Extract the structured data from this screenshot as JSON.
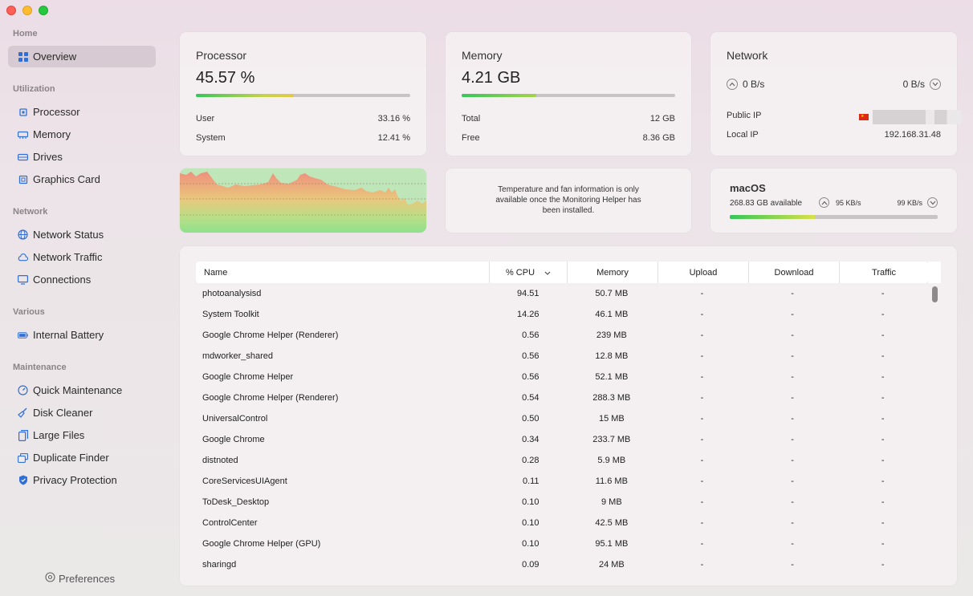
{
  "sidebar": {
    "sections": {
      "home": "Home",
      "utilization": "Utilization",
      "network": "Network",
      "various": "Various",
      "maintenance": "Maintenance"
    },
    "items": {
      "overview": "Overview",
      "processor": "Processor",
      "memory": "Memory",
      "drives": "Drives",
      "graphics": "Graphics Card",
      "network_status": "Network Status",
      "network_traffic": "Network Traffic",
      "connections": "Connections",
      "battery": "Internal Battery",
      "quick_maintenance": "Quick Maintenance",
      "disk_cleaner": "Disk Cleaner",
      "large_files": "Large Files",
      "duplicate_finder": "Duplicate Finder",
      "privacy": "Privacy Protection"
    },
    "preferences": "Preferences"
  },
  "processor": {
    "title": "Processor",
    "value": "45.57 %",
    "usage_fraction": 0.4557,
    "user_label": "User",
    "user_value": "33.16 %",
    "system_label": "System",
    "system_value": "12.41 %"
  },
  "memory": {
    "title": "Memory",
    "value": "4.21 GB",
    "usage_fraction": 0.35,
    "total_label": "Total",
    "total_value": "12 GB",
    "free_label": "Free",
    "free_value": "8.36 GB"
  },
  "network": {
    "title": "Network",
    "up_rate": "0 B/s",
    "down_rate": "0 B/s",
    "public_ip_label": "Public IP",
    "local_ip_label": "Local IP",
    "local_ip_value": "192.168.31.48"
  },
  "sensor_info": "Temperature and fan information is only available once the Monitoring Helper has been installed.",
  "disk": {
    "title": "macOS",
    "available": "268.83 GB available",
    "read_rate": "95 KB/s",
    "write_rate": "99 KB/s",
    "usage_fraction": 0.41
  },
  "table": {
    "headers": {
      "name": "Name",
      "cpu": "% CPU",
      "memory": "Memory",
      "upload": "Upload",
      "download": "Download",
      "traffic": "Traffic"
    },
    "rows": [
      {
        "name": "photoanalysisd",
        "cpu": "94.51",
        "memory": "50.7 MB",
        "upload": "-",
        "download": "-",
        "traffic": "-"
      },
      {
        "name": "System Toolkit",
        "cpu": "14.26",
        "memory": "46.1 MB",
        "upload": "-",
        "download": "-",
        "traffic": "-"
      },
      {
        "name": "Google Chrome Helper (Renderer)",
        "cpu": "0.56",
        "memory": "239 MB",
        "upload": "-",
        "download": "-",
        "traffic": "-"
      },
      {
        "name": "mdworker_shared",
        "cpu": "0.56",
        "memory": "12.8 MB",
        "upload": "-",
        "download": "-",
        "traffic": "-"
      },
      {
        "name": "Google Chrome Helper",
        "cpu": "0.56",
        "memory": "52.1 MB",
        "upload": "-",
        "download": "-",
        "traffic": "-"
      },
      {
        "name": "Google Chrome Helper (Renderer)",
        "cpu": "0.54",
        "memory": "288.3 MB",
        "upload": "-",
        "download": "-",
        "traffic": "-"
      },
      {
        "name": "UniversalControl",
        "cpu": "0.50",
        "memory": "15 MB",
        "upload": "-",
        "download": "-",
        "traffic": "-"
      },
      {
        "name": "Google Chrome",
        "cpu": "0.34",
        "memory": "233.7 MB",
        "upload": "-",
        "download": "-",
        "traffic": "-"
      },
      {
        "name": "distnoted",
        "cpu": "0.28",
        "memory": "5.9 MB",
        "upload": "-",
        "download": "-",
        "traffic": "-"
      },
      {
        "name": "CoreServicesUIAgent",
        "cpu": "0.11",
        "memory": "11.6 MB",
        "upload": "-",
        "download": "-",
        "traffic": "-"
      },
      {
        "name": "ToDesk_Desktop",
        "cpu": "0.10",
        "memory": "9 MB",
        "upload": "-",
        "download": "-",
        "traffic": "-"
      },
      {
        "name": "ControlCenter",
        "cpu": "0.10",
        "memory": "42.5 MB",
        "upload": "-",
        "download": "-",
        "traffic": "-"
      },
      {
        "name": "Google Chrome Helper (GPU)",
        "cpu": "0.10",
        "memory": "95.1 MB",
        "upload": "-",
        "download": "-",
        "traffic": "-"
      },
      {
        "name": "sharingd",
        "cpu": "0.09",
        "memory": "24 MB",
        "upload": "-",
        "download": "-",
        "traffic": "-"
      }
    ]
  },
  "colors": {
    "accent": "#2f6fd6",
    "bar_green": "#34c759",
    "bar_yellow": "#e3c84a",
    "chart_red": "#f08a7a"
  }
}
